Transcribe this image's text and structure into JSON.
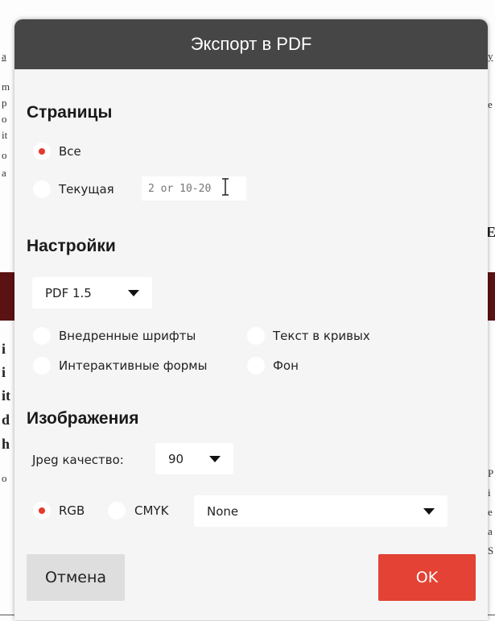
{
  "dialog": {
    "title": "Экспорт в PDF",
    "pages": {
      "heading": "Страницы",
      "all_label": "Все",
      "current_label": "Текущая",
      "range_placeholder": "2 or 10-20"
    },
    "settings": {
      "heading": "Настройки",
      "pdf_version": "PDF 1.5",
      "embedded_fonts": "Внедренные шрифты",
      "text_to_curves": "Текст в кривых",
      "interactive_forms": "Интерактивные формы",
      "background": "Фон"
    },
    "images": {
      "heading": "Изображения",
      "jpeg_quality_label": "Jpeg качество:",
      "jpeg_quality_value": "90",
      "rgb_label": "RGB",
      "cmyk_label": "CMYK",
      "color_profile": "None"
    },
    "buttons": {
      "cancel": "Отмена",
      "ok": "OK"
    }
  },
  "colors": {
    "accent": "#e34234",
    "header_bg": "#464646",
    "dialog_bg": "#f5f5f5"
  }
}
